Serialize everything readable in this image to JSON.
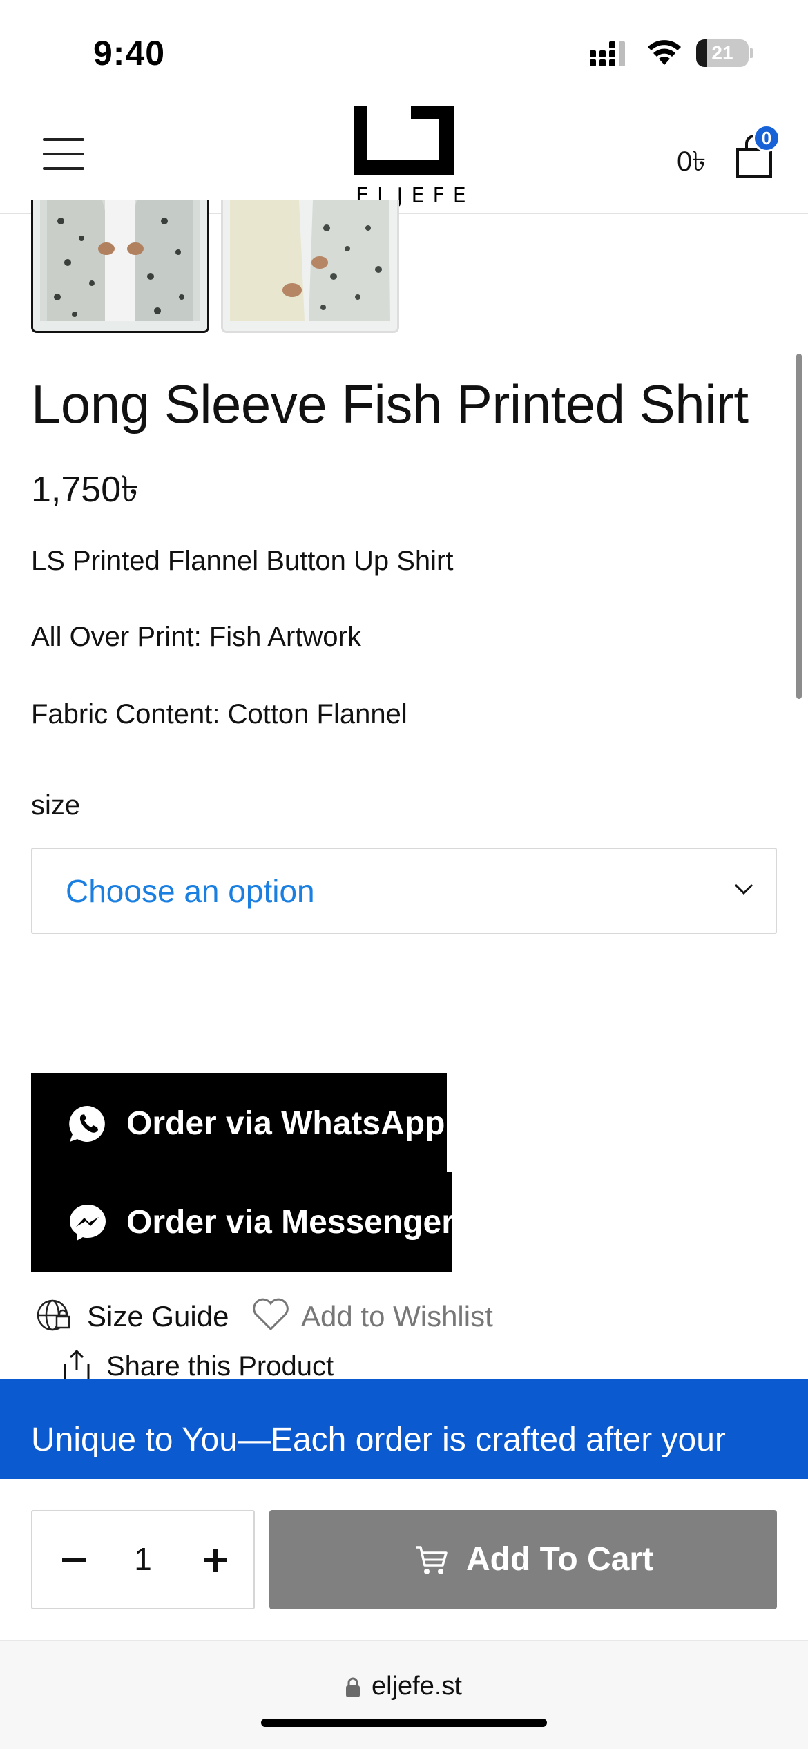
{
  "status_bar": {
    "time": "9:40",
    "battery_level": "21",
    "battery_fraction": 0.21
  },
  "header": {
    "brand": "ELJEFE",
    "cart_total": "0৳",
    "cart_count": "0"
  },
  "product": {
    "title": "Long Sleeve Fish Printed Shirt",
    "price": "1,750৳",
    "description": [
      "LS Printed Flannel Button Up Shirt",
      "All Over Print: Fish Artwork",
      "Fabric Content: Cotton Flannel"
    ],
    "thumbnails": [
      "shirt-front-thumbnail",
      "shirt-pair-thumbnail"
    ]
  },
  "options": {
    "size_label": "size",
    "size_placeholder": "Choose an option"
  },
  "actions": {
    "whatsapp_label": "Order via WhatsApp",
    "messenger_label": "Order via Messenger",
    "size_guide_label": "Size Guide",
    "wishlist_label": "Add to Wishlist",
    "share_label": "Share this Product"
  },
  "promo": {
    "text": "Unique to You—Each order is crafted after your order"
  },
  "cart_bar": {
    "quantity": "1",
    "add_to_cart_label": "Add To Cart"
  },
  "browser": {
    "url": "eljefe.st"
  },
  "colors": {
    "accent_blue": "#0b5ad0",
    "select_text": "#1a7fe0",
    "button_black": "#000000",
    "add_to_cart_gray": "#808080"
  },
  "icons": [
    "signal-icon",
    "wifi-icon",
    "battery-icon",
    "menu-icon",
    "shopping-bag-icon",
    "chevron-down-icon",
    "whatsapp-icon",
    "messenger-icon",
    "size-guide-icon",
    "heart-icon",
    "share-icon",
    "cart-icon",
    "lock-icon"
  ]
}
